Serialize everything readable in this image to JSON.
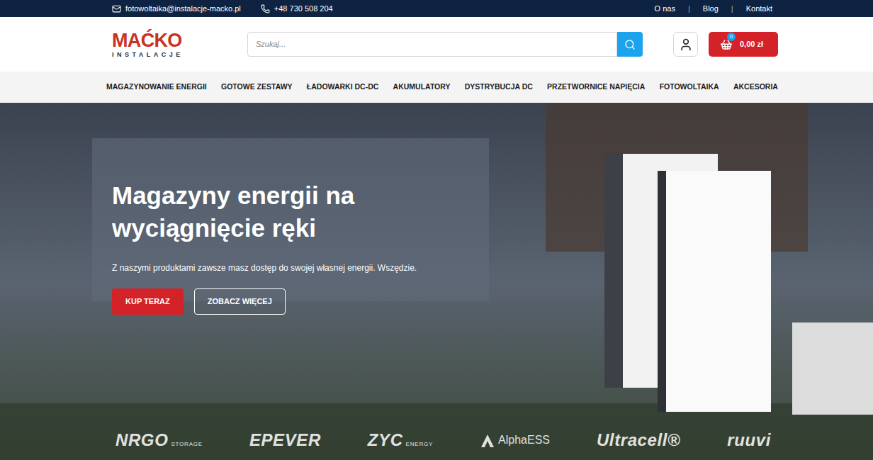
{
  "topbar": {
    "email": "fotowoltaika@instalacje-macko.pl",
    "phone": "+48 730 508 204",
    "links": [
      "O nas",
      "Blog",
      "Kontakt"
    ]
  },
  "logo": {
    "main": "MAĆKO",
    "sub": "INSTALACJE"
  },
  "search": {
    "placeholder": "Szukaj..."
  },
  "cart": {
    "count": "0",
    "total": "0,00 zł"
  },
  "nav": [
    "MAGAZYNOWANIE ENERGII",
    "GOTOWE ZESTAWY",
    "ŁADOWARKI DC-DC",
    "AKUMULATORY",
    "DYSTRYBUCJA DC",
    "PRZETWORNICE NAPIĘCIA",
    "FOTOWOLTAIKA",
    "AKCESORIA"
  ],
  "hero": {
    "title": "Magazyny energii na wyciągnięcie ręki",
    "subtitle": "Z naszymi produktami zawsze masz dostęp do swojej własnej energii. Wszędzie.",
    "buttons": [
      {
        "label": "KUP TERAZ",
        "kind": "primary"
      },
      {
        "label": "ZOBACZ WIĘCEJ",
        "kind": "outline"
      }
    ]
  },
  "brands": [
    {
      "name": "NRGO",
      "sub": "STORAGE"
    },
    {
      "name": "EPEVER",
      "sub": ""
    },
    {
      "name": "ZYC",
      "sub": "ENERGY"
    },
    {
      "name": "AlphaESS",
      "sub": ""
    },
    {
      "name": "Ultracell®",
      "sub": ""
    },
    {
      "name": "ruuvi",
      "sub": ""
    }
  ]
}
